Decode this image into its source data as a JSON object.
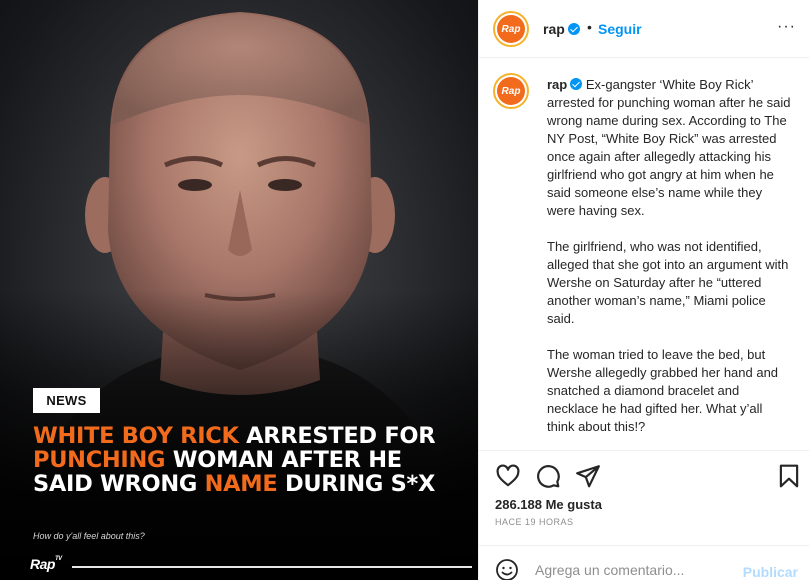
{
  "post_image": {
    "tag": "NEWS",
    "headline_parts": [
      {
        "text": "WHITE BOY RICK",
        "highlight": true
      },
      {
        "text": " ARRESTED FOR ",
        "highlight": false
      },
      {
        "text": "PUNCHING",
        "highlight": true
      },
      {
        "text": " WOMAN AFTER HE SAID WRONG ",
        "highlight": false
      },
      {
        "text": "NAME",
        "highlight": true
      },
      {
        "text": " DURING S*X",
        "highlight": false
      }
    ],
    "subline": "How do y'all feel about this?",
    "brand": "Rap",
    "brand_suffix": "TV",
    "highlight_color": "#f26b1d"
  },
  "header": {
    "avatar_text": "Rap",
    "username": "rap",
    "separator": "•",
    "follow_label": "Seguir",
    "more_label": "···"
  },
  "caption": {
    "avatar_text": "Rap",
    "username": "rap",
    "paragraph_1": "Ex-gangster ‘White Boy Rick’ arrested for punching woman after he said wrong name during sex. According to The NY Post, “White Boy Rick” was arrested once again after allegedly attacking his girlfriend who got angry at him when he said someone else’s name while they were having sex.",
    "paragraph_2": "The girlfriend, who was not identified, alleged that she got into an argument with Wershe on Saturday after he “uttered another woman’s name,” Miami police said.",
    "paragraph_3": "The woman tried to leave the bed, but Wershe allegedly grabbed her hand and snatched a diamond bracelet and necklace he had gifted her. What y’all think about this!?"
  },
  "actions": {
    "icons": [
      "heart-icon",
      "comment-icon",
      "share-icon",
      "bookmark-icon"
    ],
    "likes": "286.188 Me gusta",
    "time": "HACE 19 HORAS"
  },
  "comment_box": {
    "placeholder": "Agrega un comentario...",
    "post_label": "Publicar"
  },
  "colors": {
    "accent": "#0095f6",
    "brand_orange": "#f26b1d"
  }
}
